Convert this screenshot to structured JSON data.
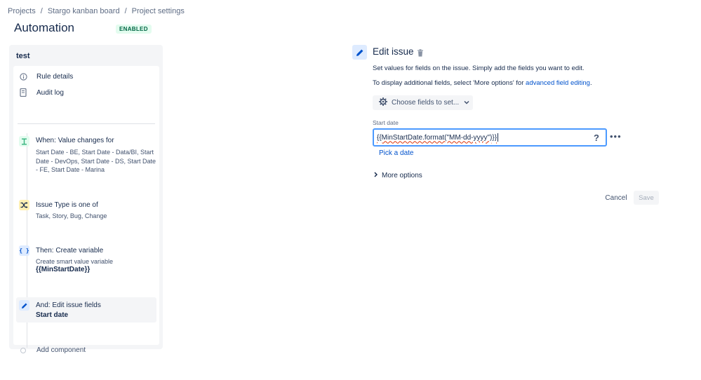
{
  "breadcrumb": [
    "Projects",
    "Stargo kanban board",
    "Project settings"
  ],
  "breadcrumb_separator": "/",
  "page": {
    "title": "Automation",
    "status": "ENABLED"
  },
  "rule": {
    "name": "test",
    "nav": [
      {
        "label": "Rule details",
        "icon": "info-icon"
      },
      {
        "label": "Audit log",
        "icon": "document-icon"
      }
    ],
    "steps": [
      {
        "title": "When: Value changes for",
        "desc": "Start Date - BE, Start Date - Data/BI, Start Date - DevOps, Start Date - DS, Start Date - FE, Start Date - Marina",
        "icon": "trigger-icon",
        "color": "#36b37e",
        "bg": "#e3fcef"
      },
      {
        "title": "Issue Type is one of",
        "desc": "Task, Story, Bug, Change",
        "icon": "condition-shuffle-icon",
        "color": "#172b4d",
        "bg": "#fff0b3"
      },
      {
        "title": "Then: Create variable",
        "desc": "Create smart value variable",
        "desc2": "{{MinStartDate}}",
        "icon": "braces-icon",
        "color": "#0052cc",
        "bg": "#deebff"
      },
      {
        "title": "And: Edit issue fields",
        "desc": "Start date",
        "icon": "pencil-icon",
        "color": "#0052cc",
        "bg": "#deebff"
      }
    ],
    "add_component": "Add component"
  },
  "editor": {
    "title": "Edit issue",
    "desc1": "Set values for fields on the issue. Simply add the fields you want to edit.",
    "desc2_prefix": "To display additional fields, select 'More options' for ",
    "desc2_link": "advanced field editing",
    "desc2_suffix": ".",
    "choose_fields": "Choose fields to set...",
    "field_label": "Start date",
    "field_value": "{{MinStartDate.format(\"MM-dd-yyyy\")}}",
    "help": "?",
    "more": "•••",
    "pick_date": "Pick a date",
    "more_options": "More options",
    "cancel": "Cancel",
    "save": "Save"
  },
  "colors": {
    "accent": "#0052cc",
    "focus": "#4c9aff",
    "enabled_bg": "#e3fcef",
    "enabled_fg": "#006644"
  }
}
